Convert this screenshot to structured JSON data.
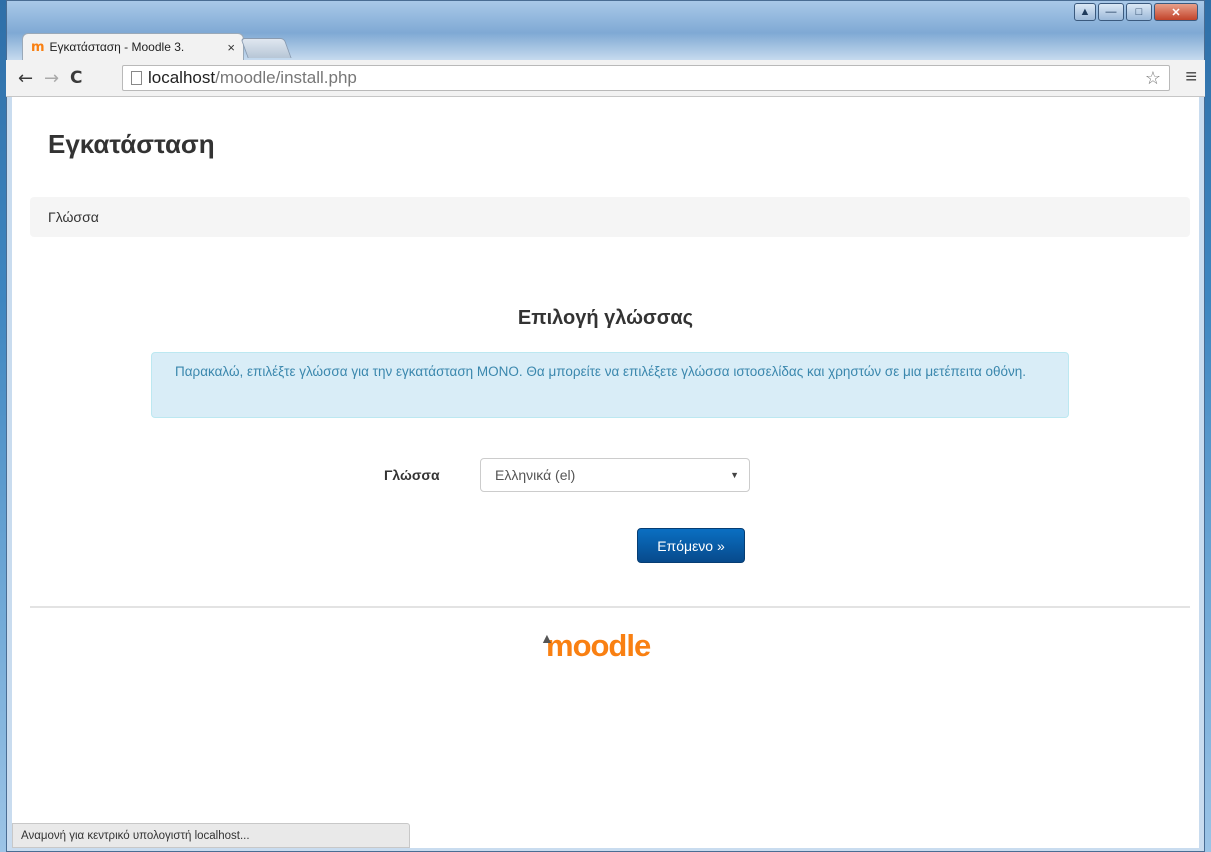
{
  "browser": {
    "tab_title": "Εγκατάσταση - Moodle 3.",
    "tab_close": "×",
    "url_host": "localhost",
    "url_path": "/moodle/install.php",
    "status_text": "Αναμονή για κεντρικό υπολογιστή localhost..."
  },
  "page": {
    "title": "Εγκατάσταση",
    "breadcrumb": "Γλώσσα",
    "section_heading": "Επιλογή γλώσσας",
    "alert_text": "Παρακαλώ, επιλέξτε γλώσσα για την εγκατάσταση ΜΟΝΟ. Θα μπορείτε να επιλέξετε γλώσσα ιστοσελίδας και χρηστών σε μια μετέπειτα οθόνη.",
    "language_label": "Γλώσσα",
    "language_selected": "Ελληνικά (el)",
    "next_button": "Επόμενο »",
    "logo_text": "moodle"
  },
  "colors": {
    "accent": "#f98012",
    "button": "#0a5aa8",
    "alert_bg": "#d9edf7",
    "alert_text": "#3a87ad"
  },
  "icons": [
    "back-arrow-icon",
    "forward-arrow-icon",
    "reload-icon",
    "page-icon",
    "star-icon",
    "menu-icon",
    "moodle-favicon-icon",
    "dropdown-arrow-icon",
    "graduation-cap-icon"
  ]
}
